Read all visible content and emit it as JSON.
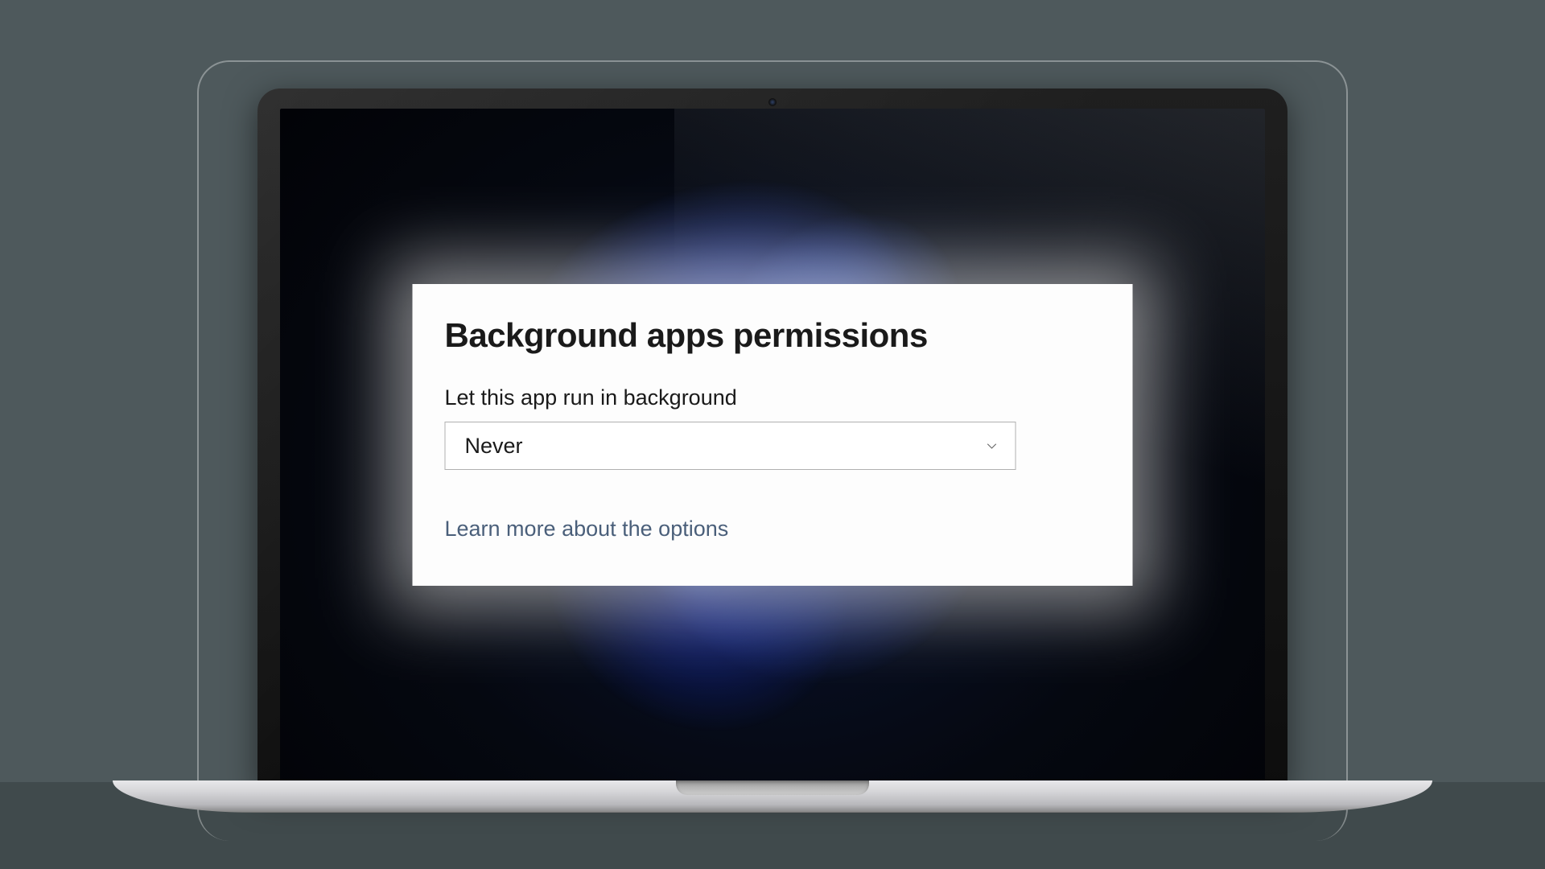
{
  "dialog": {
    "title": "Background apps permissions",
    "setting_label": "Let this app run in background",
    "dropdown_value": "Never",
    "link_text": "Learn more about the options"
  }
}
